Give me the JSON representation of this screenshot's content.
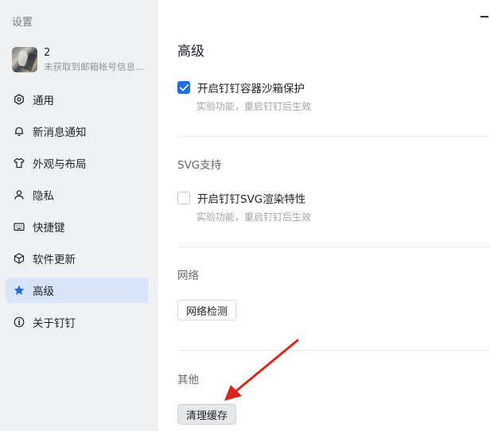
{
  "sidebar": {
    "title": "设置",
    "profile": {
      "name": "2",
      "subtitle": "未获取到邮箱帐号信息..."
    },
    "items": [
      {
        "label": "通用",
        "icon": "settings-icon",
        "active": false
      },
      {
        "label": "新消息通知",
        "icon": "bell-icon",
        "active": false
      },
      {
        "label": "外观与布局",
        "icon": "shirt-icon",
        "active": false
      },
      {
        "label": "隐私",
        "icon": "person-icon",
        "active": false
      },
      {
        "label": "快捷键",
        "icon": "keyboard-icon",
        "active": false
      },
      {
        "label": "软件更新",
        "icon": "cube-icon",
        "active": false
      },
      {
        "label": "高级",
        "icon": "star-icon",
        "active": true
      },
      {
        "label": "关于钉钉",
        "icon": "info-icon",
        "active": false
      }
    ]
  },
  "main": {
    "title": "高级",
    "sandbox": {
      "label": "开启钉钉容器沙箱保护",
      "hint": "实验功能，重启钉钉后生效",
      "checked": true
    },
    "svg_section": {
      "title": "SVG支持",
      "label": "开启钉钉SVG渲染特性",
      "hint": "实验功能，重启钉钉后生效",
      "checked": false
    },
    "network": {
      "title": "网络",
      "button": "网络检测"
    },
    "other": {
      "title": "其他",
      "button": "清理缓存"
    }
  },
  "colors": {
    "accent": "#1f6fe5",
    "active_bg": "#d9e5f8",
    "arrow": "#d9261c"
  }
}
